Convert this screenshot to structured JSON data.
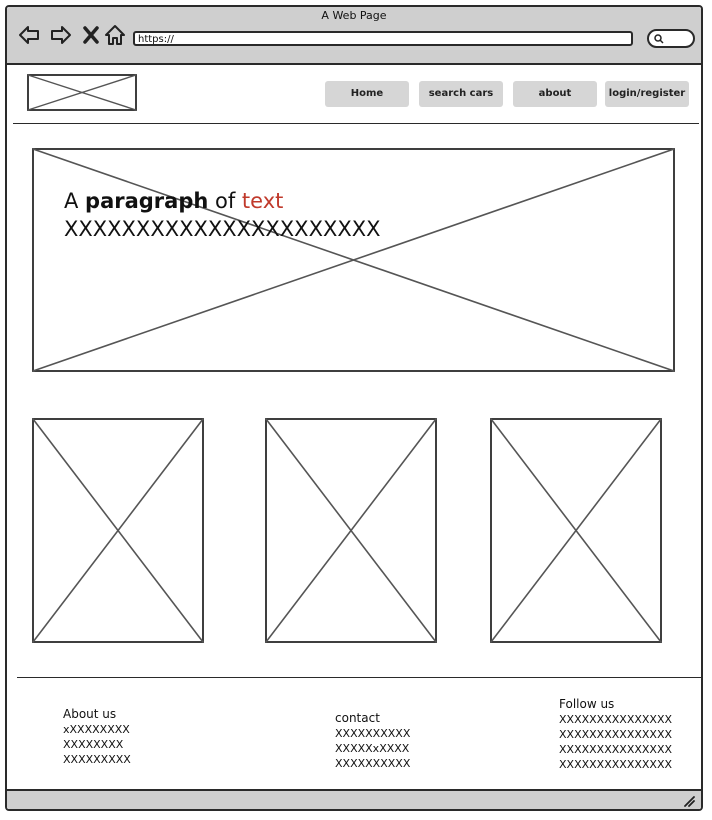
{
  "window": {
    "title": "A Web Page"
  },
  "browser": {
    "url": "https://",
    "nav": [
      "back-icon",
      "forward-icon",
      "close-icon",
      "home-icon"
    ]
  },
  "menu": [
    {
      "label": "Home"
    },
    {
      "label": "search cars"
    },
    {
      "label": "about"
    },
    {
      "label": "login/register"
    }
  ],
  "hero": {
    "text_a": "A ",
    "text_bold": "paragraph",
    "text_of": " of ",
    "text_red": "text",
    "line2": "XXXXXXXXXXXXXXXXXXXXXX"
  },
  "footer": {
    "about": {
      "heading": "About us",
      "lines": [
        "xXXXXXXXX",
        "XXXXXXXX",
        "XXXXXXXXX"
      ]
    },
    "contact": {
      "heading": "contact",
      "lines": [
        "XXXXXXXXXX",
        "XXXXXxXXXX",
        "XXXXXXXXXX"
      ]
    },
    "follow": {
      "heading": "Follow us",
      "lines": [
        "XXXXXXXXXXXXXXX",
        "XXXXXXXXXXXXXXX",
        "XXXXXXXXXXXXXXX",
        "XXXXXXXXXXXXXXX"
      ]
    }
  },
  "colors": {
    "accent_red": "#c0392b",
    "chrome_gray": "#cfcfcf",
    "button_gray": "#d6d6d6"
  }
}
